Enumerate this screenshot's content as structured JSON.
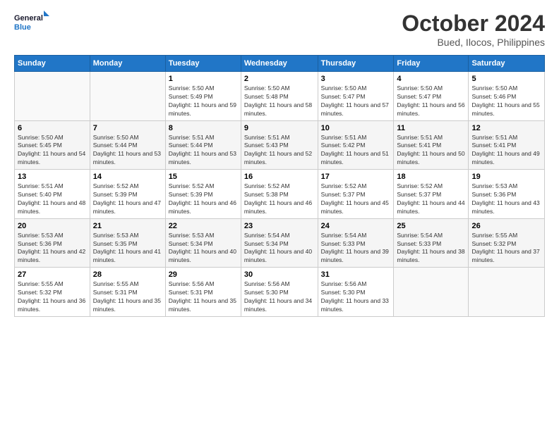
{
  "header": {
    "logo_line1": "General",
    "logo_line2": "Blue",
    "month": "October 2024",
    "location": "Bued, Ilocos, Philippines"
  },
  "days_of_week": [
    "Sunday",
    "Monday",
    "Tuesday",
    "Wednesday",
    "Thursday",
    "Friday",
    "Saturday"
  ],
  "weeks": [
    [
      {
        "day": "",
        "info": ""
      },
      {
        "day": "",
        "info": ""
      },
      {
        "day": "1",
        "info": "Sunrise: 5:50 AM\nSunset: 5:49 PM\nDaylight: 11 hours and 59 minutes."
      },
      {
        "day": "2",
        "info": "Sunrise: 5:50 AM\nSunset: 5:48 PM\nDaylight: 11 hours and 58 minutes."
      },
      {
        "day": "3",
        "info": "Sunrise: 5:50 AM\nSunset: 5:47 PM\nDaylight: 11 hours and 57 minutes."
      },
      {
        "day": "4",
        "info": "Sunrise: 5:50 AM\nSunset: 5:47 PM\nDaylight: 11 hours and 56 minutes."
      },
      {
        "day": "5",
        "info": "Sunrise: 5:50 AM\nSunset: 5:46 PM\nDaylight: 11 hours and 55 minutes."
      }
    ],
    [
      {
        "day": "6",
        "info": "Sunrise: 5:50 AM\nSunset: 5:45 PM\nDaylight: 11 hours and 54 minutes."
      },
      {
        "day": "7",
        "info": "Sunrise: 5:50 AM\nSunset: 5:44 PM\nDaylight: 11 hours and 53 minutes."
      },
      {
        "day": "8",
        "info": "Sunrise: 5:51 AM\nSunset: 5:44 PM\nDaylight: 11 hours and 53 minutes."
      },
      {
        "day": "9",
        "info": "Sunrise: 5:51 AM\nSunset: 5:43 PM\nDaylight: 11 hours and 52 minutes."
      },
      {
        "day": "10",
        "info": "Sunrise: 5:51 AM\nSunset: 5:42 PM\nDaylight: 11 hours and 51 minutes."
      },
      {
        "day": "11",
        "info": "Sunrise: 5:51 AM\nSunset: 5:41 PM\nDaylight: 11 hours and 50 minutes."
      },
      {
        "day": "12",
        "info": "Sunrise: 5:51 AM\nSunset: 5:41 PM\nDaylight: 11 hours and 49 minutes."
      }
    ],
    [
      {
        "day": "13",
        "info": "Sunrise: 5:51 AM\nSunset: 5:40 PM\nDaylight: 11 hours and 48 minutes."
      },
      {
        "day": "14",
        "info": "Sunrise: 5:52 AM\nSunset: 5:39 PM\nDaylight: 11 hours and 47 minutes."
      },
      {
        "day": "15",
        "info": "Sunrise: 5:52 AM\nSunset: 5:39 PM\nDaylight: 11 hours and 46 minutes."
      },
      {
        "day": "16",
        "info": "Sunrise: 5:52 AM\nSunset: 5:38 PM\nDaylight: 11 hours and 46 minutes."
      },
      {
        "day": "17",
        "info": "Sunrise: 5:52 AM\nSunset: 5:37 PM\nDaylight: 11 hours and 45 minutes."
      },
      {
        "day": "18",
        "info": "Sunrise: 5:52 AM\nSunset: 5:37 PM\nDaylight: 11 hours and 44 minutes."
      },
      {
        "day": "19",
        "info": "Sunrise: 5:53 AM\nSunset: 5:36 PM\nDaylight: 11 hours and 43 minutes."
      }
    ],
    [
      {
        "day": "20",
        "info": "Sunrise: 5:53 AM\nSunset: 5:36 PM\nDaylight: 11 hours and 42 minutes."
      },
      {
        "day": "21",
        "info": "Sunrise: 5:53 AM\nSunset: 5:35 PM\nDaylight: 11 hours and 41 minutes."
      },
      {
        "day": "22",
        "info": "Sunrise: 5:53 AM\nSunset: 5:34 PM\nDaylight: 11 hours and 40 minutes."
      },
      {
        "day": "23",
        "info": "Sunrise: 5:54 AM\nSunset: 5:34 PM\nDaylight: 11 hours and 40 minutes."
      },
      {
        "day": "24",
        "info": "Sunrise: 5:54 AM\nSunset: 5:33 PM\nDaylight: 11 hours and 39 minutes."
      },
      {
        "day": "25",
        "info": "Sunrise: 5:54 AM\nSunset: 5:33 PM\nDaylight: 11 hours and 38 minutes."
      },
      {
        "day": "26",
        "info": "Sunrise: 5:55 AM\nSunset: 5:32 PM\nDaylight: 11 hours and 37 minutes."
      }
    ],
    [
      {
        "day": "27",
        "info": "Sunrise: 5:55 AM\nSunset: 5:32 PM\nDaylight: 11 hours and 36 minutes."
      },
      {
        "day": "28",
        "info": "Sunrise: 5:55 AM\nSunset: 5:31 PM\nDaylight: 11 hours and 35 minutes."
      },
      {
        "day": "29",
        "info": "Sunrise: 5:56 AM\nSunset: 5:31 PM\nDaylight: 11 hours and 35 minutes."
      },
      {
        "day": "30",
        "info": "Sunrise: 5:56 AM\nSunset: 5:30 PM\nDaylight: 11 hours and 34 minutes."
      },
      {
        "day": "31",
        "info": "Sunrise: 5:56 AM\nSunset: 5:30 PM\nDaylight: 11 hours and 33 minutes."
      },
      {
        "day": "",
        "info": ""
      },
      {
        "day": "",
        "info": ""
      }
    ]
  ]
}
